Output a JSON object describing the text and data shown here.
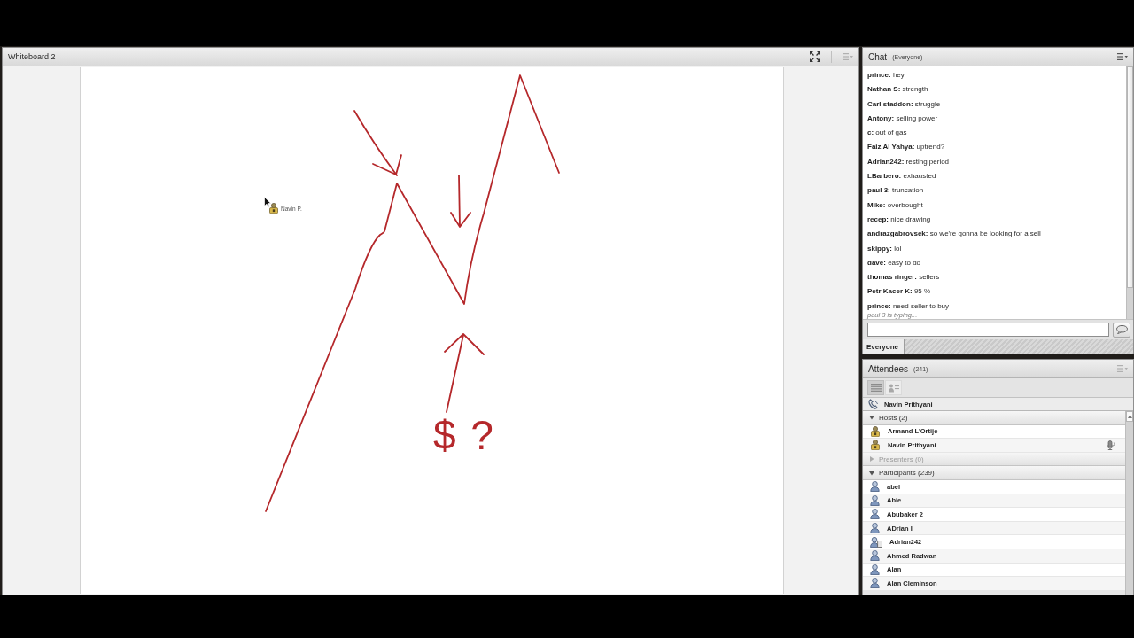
{
  "whiteboard": {
    "title": "Whiteboard 2",
    "sketch_text": "$ ?",
    "pointer_label": "Navin P."
  },
  "chat": {
    "title": "Chat",
    "audience": "(Everyone)",
    "messages": [
      "**prince:** hey",
      "**Nathan S:** strength",
      "**Carl staddon:** struggle",
      "**Antony:** selling power",
      "**c:** out of gas",
      "**Faiz Al Yahya:** uptrend?",
      "**Adrian242:** resting period",
      "**LBarbero:** exhausted",
      "**paul 3:** truncation",
      "**Mike:** overbought",
      "**recep:** nice drawing",
      "**andrazgabrovsek:** so we're gonna be looking for a sell",
      "**skippy:** lol",
      "**dave:** easy to do",
      "**thomas ringer:** sellers",
      "**Petr Kacer K:** 95 %",
      "**prince:** need seller to buy"
    ],
    "typing_notice": "paul 3 is typing...",
    "tabs": [
      {
        "label": "Everyone",
        "selected": true
      }
    ]
  },
  "attendees": {
    "title": "Attendees",
    "count": "(241)",
    "view_buttons": [
      {
        "kind": "list",
        "selected": true
      },
      {
        "kind": "detail",
        "selected": false
      }
    ],
    "speaker": "Navin Prithyani",
    "groups": [
      {
        "label": "Hosts (2)",
        "expanded": true,
        "children": [
          {
            "name": "Armand L'Ortije",
            "kind": "host",
            "speaking": false
          },
          {
            "name": "Navin Prithyani",
            "kind": "host",
            "speaking": true
          }
        ]
      },
      {
        "label": "Presenters (0)",
        "expanded": false
      },
      {
        "label": "Participants (239)",
        "expanded": true,
        "children": [
          {
            "name": "abel",
            "kind": "participant",
            "speaking": false
          },
          {
            "name": "Abie",
            "kind": "participant",
            "speaking": false
          },
          {
            "name": "Abubaker 2",
            "kind": "participant",
            "speaking": false
          },
          {
            "name": "ADrian I",
            "kind": "participant",
            "speaking": false
          },
          {
            "name": "Adrian242",
            "kind": "mobile",
            "speaking": false
          },
          {
            "name": "Ahmed Radwan",
            "kind": "participant",
            "speaking": false
          },
          {
            "name": "Alan",
            "kind": "participant",
            "speaking": false
          },
          {
            "name": "Alan Cleminson",
            "kind": "participant",
            "speaking": false
          }
        ]
      }
    ]
  }
}
